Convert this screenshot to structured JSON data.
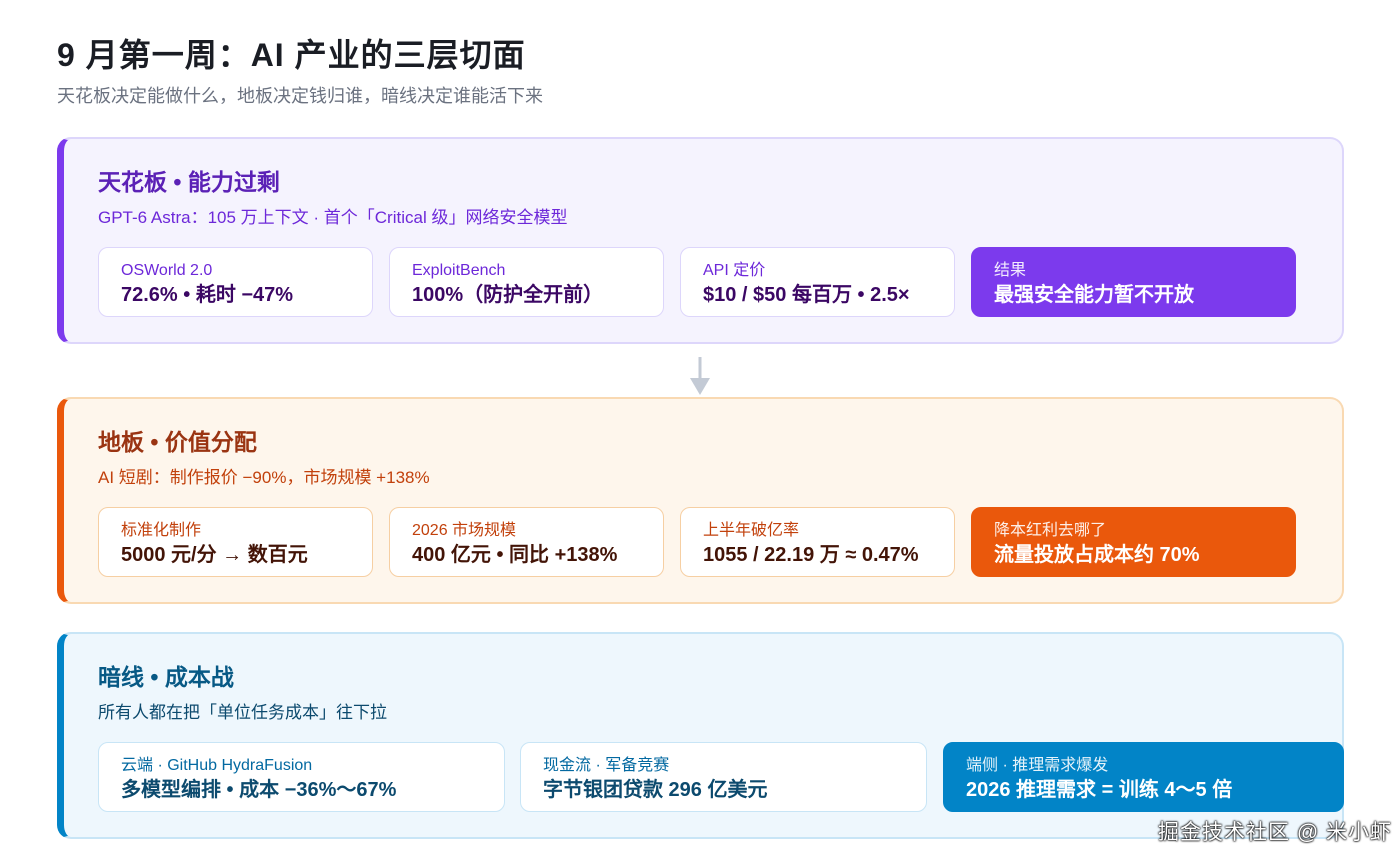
{
  "header": {
    "title": "9 月第一周：AI 产业的三层切面",
    "subtitle": "天花板决定能做什么，地板决定钱归谁，暗线决定谁能活下来"
  },
  "layers": {
    "ceiling": {
      "title": "天花板 • 能力过剩",
      "subtitle": "GPT-6 Astra：105 万上下文 · 首个「Critical 级」网络安全模型",
      "accent": "#7c3aed",
      "cards": [
        {
          "label": "OSWorld 2.0",
          "value": "72.6% • 耗时 −47%"
        },
        {
          "label": "ExploitBench",
          "value": "100%（防护全开前）"
        },
        {
          "label": "API 定价",
          "value": "$10 / $50 每百万 • 2.5×"
        },
        {
          "label": "结果",
          "value": "最强安全能力暂不开放"
        }
      ]
    },
    "floor": {
      "title": "地板 • 价值分配",
      "subtitle": "AI 短剧：制作报价 −90%，市场规模 +138%",
      "accent": "#ea580c",
      "cards": [
        {
          "label": "标准化制作",
          "value": "5000 元/分 → 数百元"
        },
        {
          "label": "2026 市场规模",
          "value": "400 亿元 • 同比 +138%"
        },
        {
          "label": "上半年破亿率",
          "value": "1055 / 22.19 万 ≈ 0.47%"
        },
        {
          "label": "降本红利去哪了",
          "value": "流量投放占成本约 70%"
        }
      ]
    },
    "dark": {
      "title": "暗线 • 成本战",
      "subtitle": "所有人都在把「单位任务成本」往下拉",
      "accent": "#0284c7",
      "cards": [
        {
          "label": "云端 · GitHub HydraFusion",
          "value": "多模型编排 • 成本 −36%～67%"
        },
        {
          "label": "现金流 · 军备竞赛",
          "value": "字节银团贷款 296 亿美元"
        },
        {
          "label": "端侧 · 推理需求爆发",
          "value": "2026 推理需求 = 训练 4～5 倍"
        }
      ]
    }
  },
  "connector_icon": "arrow-down-icon",
  "watermark": "掘金技术社区 @ 米小虾"
}
